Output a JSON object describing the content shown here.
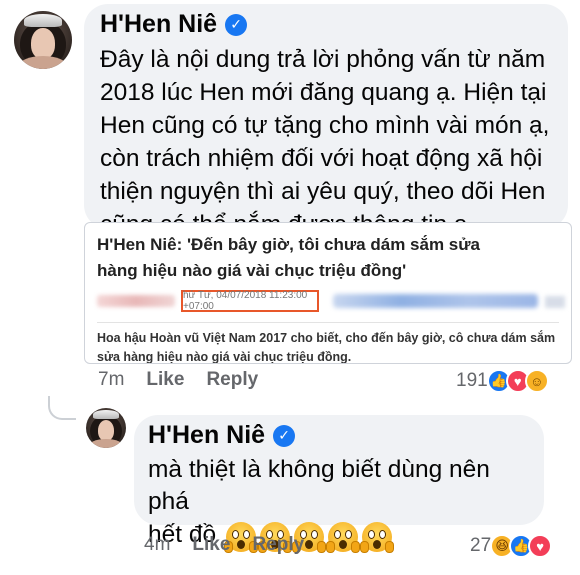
{
  "comment1": {
    "author": "H'Hen Niê",
    "verified_icon": "verified-badge-icon",
    "text_lines": [
      "Đây là nội dung trả lời phỏng vấn từ năm",
      "2018 lúc Hen mới đăng quang ạ.  Hiện tại",
      "Hen cũng có tự tặng cho mình vài món ạ,",
      "còn trách nhiệm đối với hoạt động xã hội",
      "thiện nguyện thì ai yêu quý, theo dõi Hen",
      "cũng có thể nắm được thông tin ạ"
    ],
    "quote": {
      "title_lines": [
        "H'Hen Niê: 'Đến bây giờ, tôi chưa dám sắm sửa",
        "hàng hiệu nào giá vài chục triệu đồng'"
      ],
      "date": "hứ Tư, 04/07/2018 11:23:00 +07:00",
      "description_lines": [
        "Hoa hậu Hoàn vũ Việt Nam 2017 cho biết, cho đến bây giờ, cô chưa dám sắm",
        "sửa hàng hiệu nào giá vài chục triệu đồng."
      ]
    },
    "time": "7m",
    "like_label": "Like",
    "reply_label": "Reply",
    "reaction_count": "191",
    "reactions": [
      "like",
      "love",
      "care"
    ]
  },
  "comment2": {
    "author": "H'Hen Niê",
    "verified_icon": "verified-badge-icon",
    "text_lines": [
      "mà thiệt là không biết dùng nên phá",
      "hết đồ"
    ],
    "emoji_name": "face-screaming-in-fear-icon",
    "emoji_count": 5,
    "time": "4m",
    "like_label": "Like",
    "reply_label": "Reply",
    "reaction_count": "27",
    "reactions": [
      "haha",
      "like",
      "love"
    ]
  },
  "colors": {
    "bubble": "#f0f2f5",
    "verified": "#1877f2",
    "meta_text": "#65676b",
    "date_box_border": "#e8572a"
  }
}
